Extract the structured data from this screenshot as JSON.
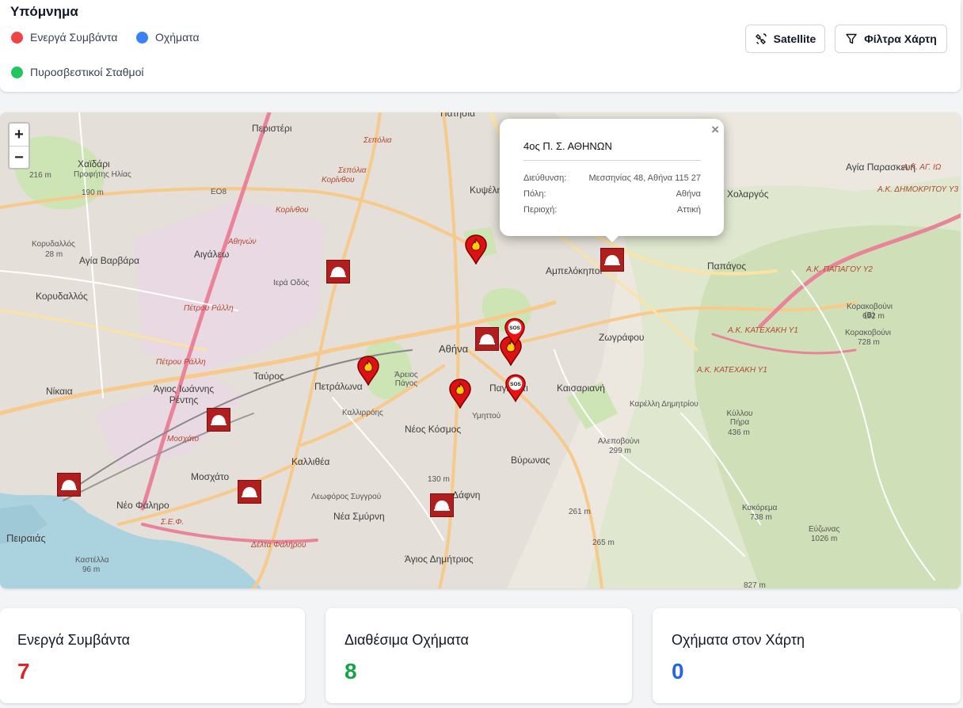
{
  "legend": {
    "title": "Υπόμνημα",
    "items": [
      {
        "label": "Ενεργά Συμβάντα",
        "color": "#ef4444"
      },
      {
        "label": "Οχήματα",
        "color": "#3b82f6"
      },
      {
        "label": "Πυροσβεστικοί Σταθμοί",
        "color": "#22c55e"
      }
    ]
  },
  "toolbar": {
    "satellite_label": "Satellite",
    "filters_label": "Φίλτρα Χάρτη"
  },
  "map": {
    "zoom_in": "+",
    "zoom_out": "−",
    "places": {
      "peristeri": "Περιστέρι",
      "patisia": "Πατήσια",
      "chaidari": "Χαϊδάρι",
      "profitis_ilias": "Προφήτης Ηλίας",
      "m190": "190 m",
      "m216": "216 m",
      "eo8": "ΕΟ8",
      "aigaleo": "Αιγάλεω",
      "agia_varvara": "Αγία Βαρβάρα",
      "korydallos_hill": "Κορυδαλλός",
      "m28": "28 m",
      "korydallos": "Κορυδαλλός",
      "nikaia": "Νίκαια",
      "agios_ioannis": "Άγιος Ιωάννης Ρέντης",
      "tavros": "Ταύρος",
      "petralona": "Πετράλωνα",
      "athina": "Αθήνα",
      "areios_pagos": "Άρειος Πάγος",
      "kypseli": "Κυψέλη",
      "ampelokipoi": "Αμπελόκηποι",
      "agia_paraskevi": "Αγία Παρασκευή",
      "cholargos": "Χολαργός",
      "papagos": "Παπάγος",
      "zografou": "Ζωγράφου",
      "kaisariani": "Καισαριανή",
      "pagkrati": "Παγκράτι",
      "neos_kosmos": "Νέος Κόσμος",
      "kallithea": "Καλλιθέα",
      "moschato": "Μοσχάτο",
      "neo_faliro": "Νέο Φάληρο",
      "peiraias": "Πειραιάς",
      "kastella": "Καστέλλα",
      "m96": "96 m",
      "nea_smyrni": "Νέα Σμύρνη",
      "agios_dimitrios": "Άγιος Δημήτριος",
      "vyronas": "Βύρωνας",
      "dafni": "Δάφνη",
      "m130": "130 m",
      "m261": "261 m",
      "m265": "265 m",
      "alepovouni": "Αλεποβούνι",
      "m299": "299 m",
      "kyllou_pira": "Κύλλου Πήρα",
      "m436": "436 m",
      "kakorema": "Κακόρεμα",
      "m738": "738 m",
      "evzonas": "Εύζωνας",
      "m1026": "1026 m",
      "m827": "827 m",
      "korakovouni_b": "Κορακοβούνι (Β)",
      "m692": "692 m",
      "korakovouni": "Κορακοβούνι",
      "m728": "728 m",
      "ak_katechaki": "Α.Κ. ΚΑΤΕΧΑΚΗ Υ1",
      "ak_katechaki2": "Α.Κ. ΚΑΤΕΧΑΚΗ Υ1",
      "ak_papagou": "Α.Κ. ΠΑΠΑΓΟΥ Υ2",
      "ak_dimokritou": "Α.Κ. ΔΗΜΟΚΡΙΤΟΥ Υ3",
      "ak_ag": "Α.Κ. ΑΓ. ΙΩ",
      "road_ymittou": "Υμηττού",
      "road_karaoli": "Καρέλλη Δημητρίου",
      "road_kallirrois": "Καλλιρρόης",
      "road_syggrou": "Λεωφόρος Συγγρού",
      "road_iera": "Ιερά Οδός",
      "road_petrou_ralli": "Πέτρου Ράλλη",
      "road_athinon": "Αθηνών",
      "road_sepolia": "Σεπόλια",
      "road_korinthou": "Κορίνθου",
      "road_delta_falirou": "Δέλτα Φαλήρου",
      "road_moschato_st": "Μοσχάτο",
      "road_sef": "Σ.Ε.Φ."
    },
    "popup": {
      "title": "4ος Π. Σ. ΑΘΗΝΩΝ",
      "close": "×",
      "rows": [
        {
          "label": "Διεύθυνση:",
          "value": "Μεσσηνίας 48, Αθήνα 115 27"
        },
        {
          "label": "Πόλη:",
          "value": "Αθήνα"
        },
        {
          "label": "Περιοχή:",
          "value": "Αττική"
        }
      ]
    },
    "sos_text": "SOS"
  },
  "stats": [
    {
      "label": "Ενεργά Συμβάντα",
      "value": "7",
      "color": "#dc2626"
    },
    {
      "label": "Διαθέσιμα Οχήματα",
      "value": "8",
      "color": "#16a34a"
    },
    {
      "label": "Οχήματα στον Χάρτη",
      "value": "0",
      "color": "#2563eb"
    }
  ],
  "icons": [
    "satellite-icon",
    "filter-icon",
    "fire-station-icon",
    "fire-incident-icon",
    "sos-incident-icon"
  ]
}
